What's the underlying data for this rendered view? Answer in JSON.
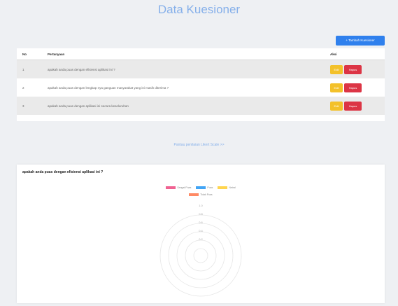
{
  "page_title": "Data Kuesioner",
  "add_button_label": "+ Tambah Kuesioner",
  "table": {
    "headers": [
      "No",
      "Pertanyaan",
      "Aksi"
    ],
    "rows": [
      {
        "no": "1",
        "question": "apakah anda puas dengan efisiensi aplikasi ini ?"
      },
      {
        "no": "2",
        "question": "apakah anda puas dengan lengkap nya ganguan masyarakat yang ini masih diterima ?"
      },
      {
        "no": "3",
        "question": "apakah anda puas dengan aplikasi ini secara keseluruhan"
      }
    ],
    "edit_label": "Edit",
    "delete_label": "Hapus"
  },
  "likert_link": "Pantau penilaian Likert Scale >>",
  "chart_title": "apakah anda puas dengan efisiensi aplikasi ini ?",
  "legend": [
    {
      "label": "Sangat Puas",
      "color": "#f06292"
    },
    {
      "label": "Puas",
      "color": "#42a5f5"
    },
    {
      "label": "Netral",
      "color": "#ffd54f"
    },
    {
      "label": "Tidak Puas",
      "color": "#ff8a65"
    }
  ],
  "chart_ticks": [
    "1.0",
    "0.8",
    "0.6",
    "0.4",
    "0.2"
  ]
}
